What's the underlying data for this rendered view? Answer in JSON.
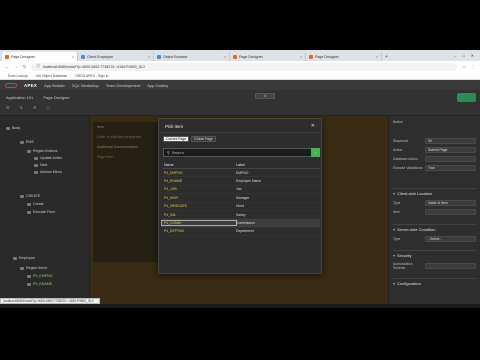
{
  "browser": {
    "tabs": [
      {
        "label": "Page Designer",
        "active": true
      },
      {
        "label": "Client Employee",
        "active": false
      },
      {
        "label": "Object Browser",
        "active": false
      },
      {
        "label": "Page Designer",
        "active": false
      },
      {
        "label": "Page Designer",
        "active": false
      }
    ],
    "url": "localhost:8080/ords/f?p=4000:4500:7738370:::4150:P4500_ID:2",
    "bookmarks": [
      "Exec Lookup",
      "Get Object Database",
      "ORDS APEX - Sign In"
    ]
  },
  "apex": {
    "brand": "APEX",
    "menus": [
      "App Builder",
      "SQL Workshop",
      "Team Development",
      "App Gallery"
    ],
    "page_number": "4",
    "user": [
      "Ibrahim",
      "Naser"
    ],
    "breadcrumb": [
      "Application 101",
      "Page Designer"
    ]
  },
  "left_tree": [
    {
      "label": "Body",
      "style": "plain",
      "indent": 0
    },
    {
      "label": "EMS",
      "style": "plain",
      "indent": 2
    },
    {
      "label": "Region Buttons",
      "style": "plain",
      "indent": 3
    },
    {
      "label": "Update Action",
      "style": "plain",
      "indent": 4
    },
    {
      "label": "Next",
      "style": "plain",
      "indent": 4
    },
    {
      "label": "Actions Menu",
      "style": "plain",
      "indent": 4
    },
    {
      "label": "CREATE",
      "style": "plain",
      "indent": 2
    },
    {
      "label": "Create",
      "style": "plain",
      "indent": 3
    },
    {
      "label": "Execute Form",
      "style": "plain",
      "indent": 3
    },
    {
      "label": "Employee",
      "style": "plain",
      "indent": 1
    },
    {
      "label": "Region Items",
      "style": "plain",
      "indent": 2
    },
    {
      "label": "P4_EMPNO",
      "style": "grn",
      "indent": 3
    },
    {
      "label": "P4_ENAME",
      "style": "grn",
      "indent": 3
    }
  ],
  "center": {
    "region_title": "Item",
    "hint": "Enter or edit item properties",
    "section": "Additional Documentation",
    "bullet": "Page Item"
  },
  "right_panel": {
    "title": "Button",
    "fields": [
      {
        "label": "Sequence",
        "value": "30"
      },
      {
        "label": "Action",
        "value": "Submit Page"
      },
      {
        "label": "Database Action",
        "value": ""
      },
      {
        "label": "Execute Validations",
        "value": "True"
      }
    ],
    "sections": [
      "Client-side Location",
      "Server-side Condition",
      "Security",
      "Configuration"
    ],
    "server_condition_type": "- Select -",
    "auth_label": "Authorization Scheme",
    "type_label": "Type",
    "type_value": "Value of Item",
    "item_label": "Item"
  },
  "modal": {
    "title": "Pick Item",
    "close_icon": "close-icon",
    "tabs": [
      "Current Page",
      "Global Page"
    ],
    "search_placeholder": "Search",
    "search_button_icon": "arrow-right-icon",
    "columns": [
      "Name",
      "Label"
    ],
    "rows": [
      {
        "name": "P4_EMPNO",
        "label": "EMPNO"
      },
      {
        "name": "P4_ENAME",
        "label": "Employee Name"
      },
      {
        "name": "P4_JOB",
        "label": "Job"
      },
      {
        "name": "P4_MGR",
        "label": "Manager"
      },
      {
        "name": "P4_HIREDATE",
        "label": "Hired"
      },
      {
        "name": "P4_SAL",
        "label": "Salary"
      },
      {
        "name": "P4_COMM",
        "label": "Commission",
        "highlighted": true
      },
      {
        "name": "P4_DEPTNO",
        "label": "Department"
      }
    ]
  },
  "status_url": "localhost:8080/ords/f?p=4000:4500:7738370:::4150:P4500_ID:2"
}
